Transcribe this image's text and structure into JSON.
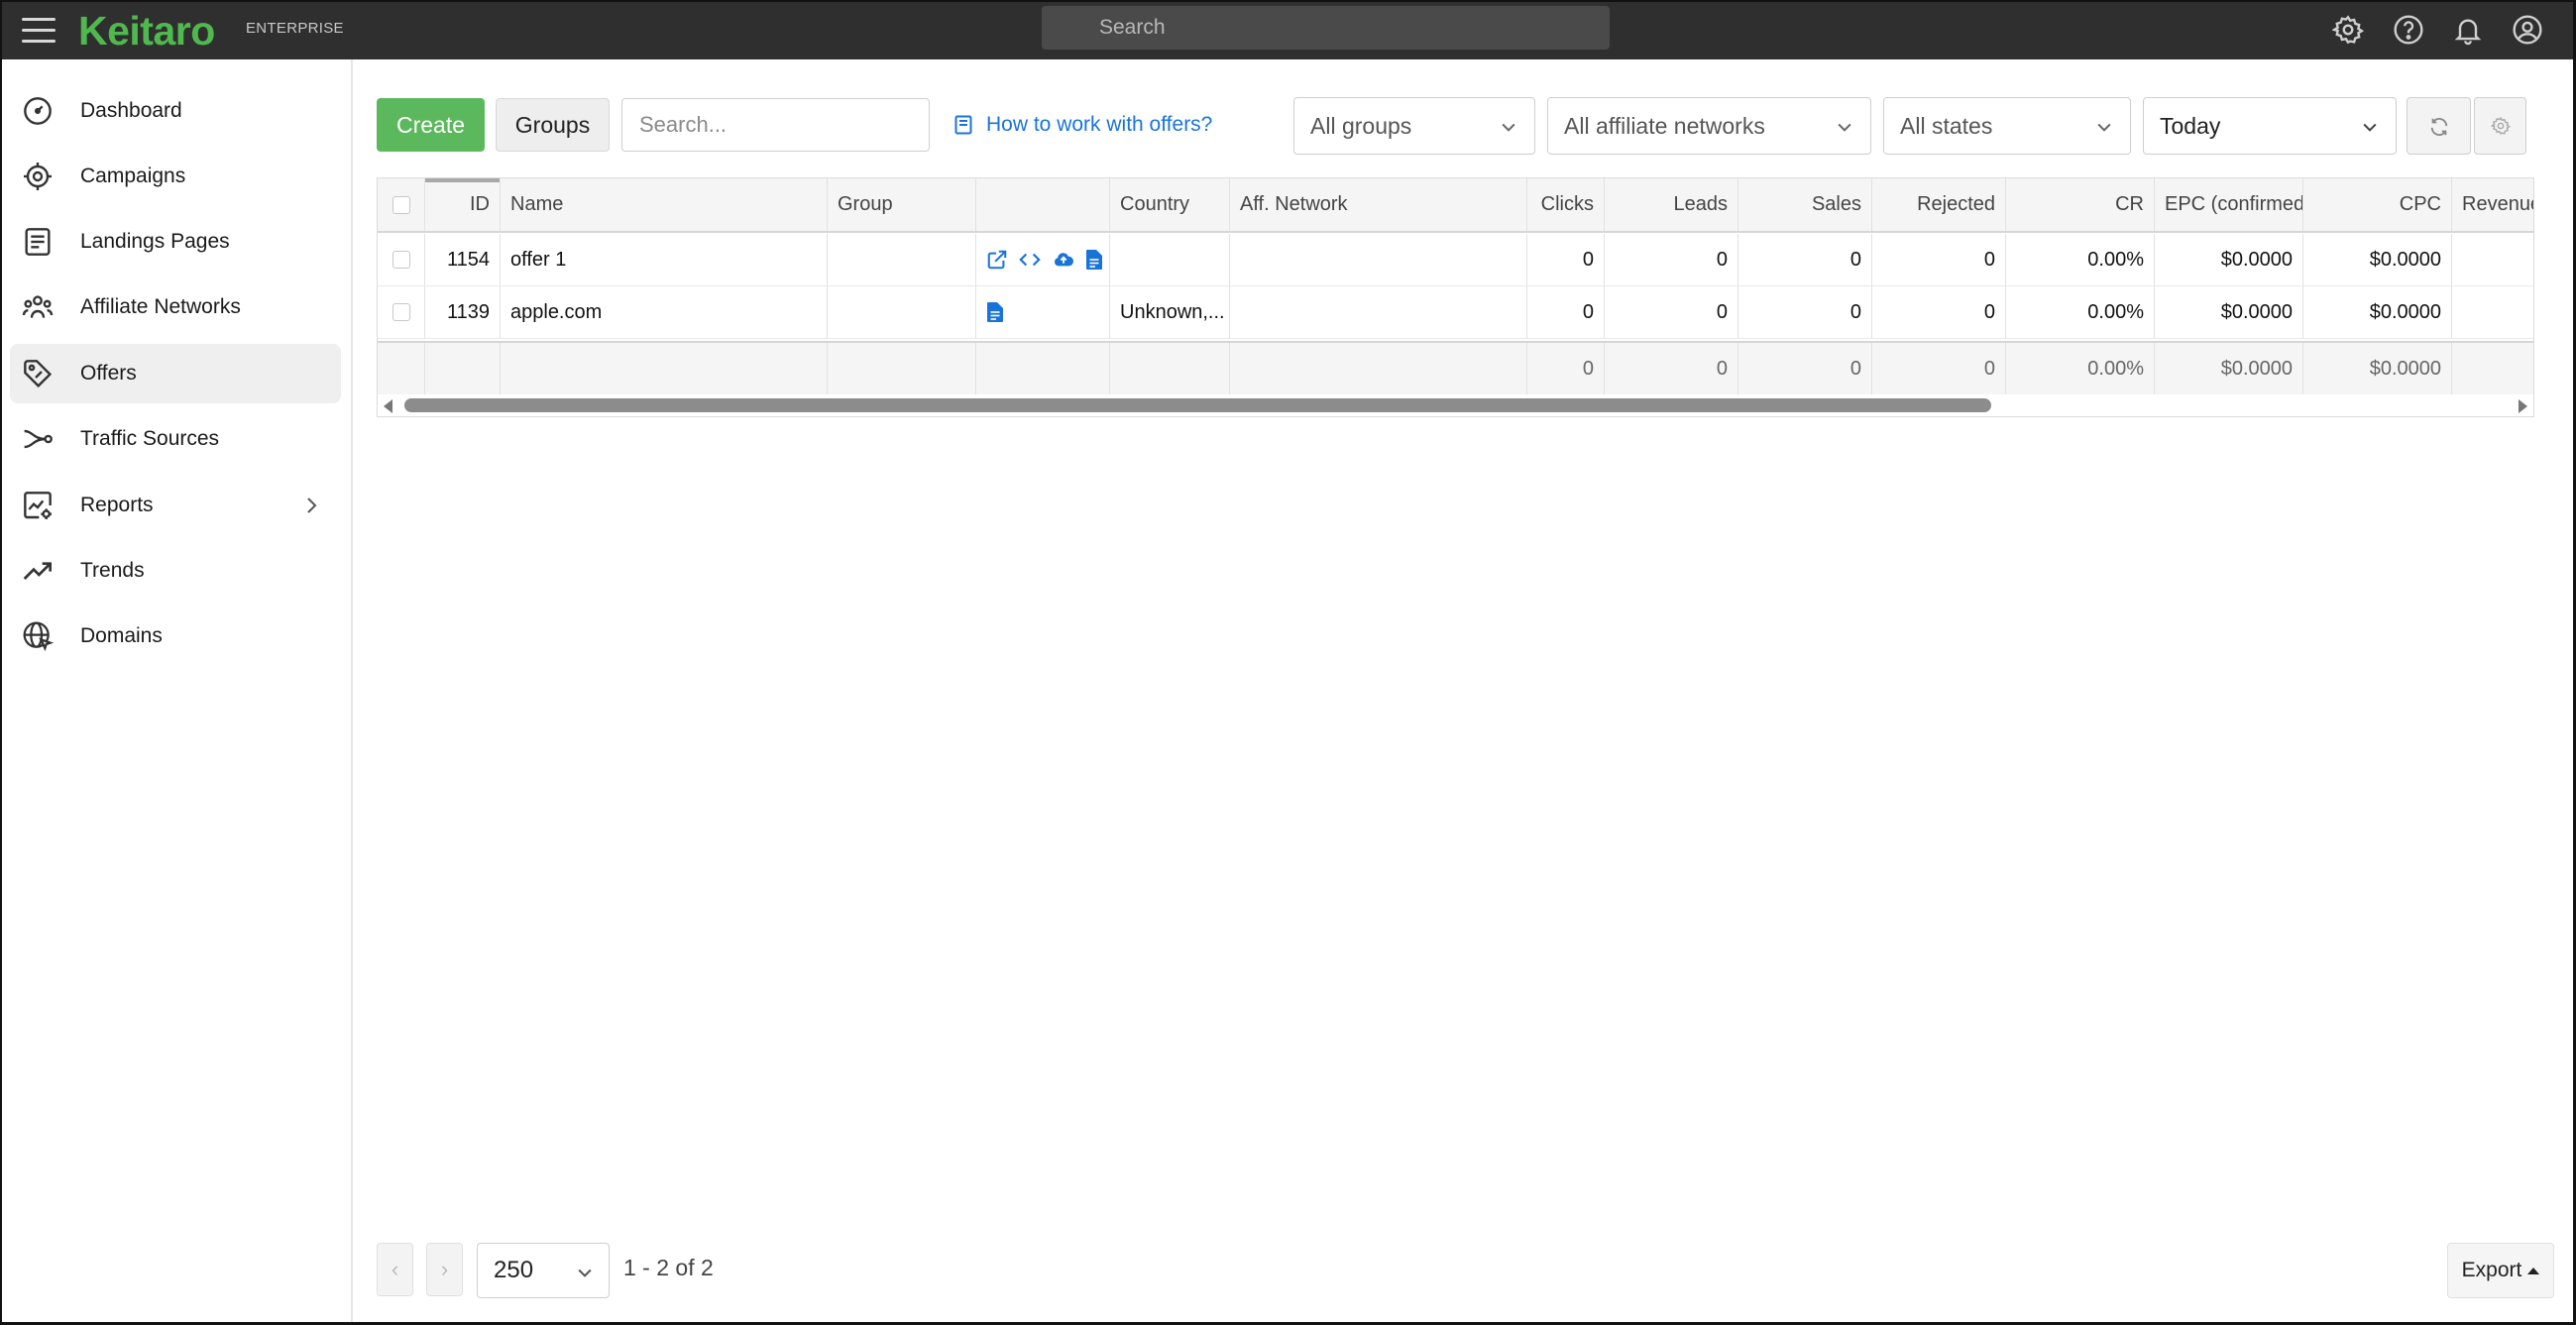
{
  "app": {
    "logo": "Keitaro",
    "edition": "ENTERPRISE",
    "search_placeholder": "Search"
  },
  "sidebar": {
    "items": [
      {
        "label": "Dashboard",
        "icon": "dashboard-icon"
      },
      {
        "label": "Campaigns",
        "icon": "target-icon"
      },
      {
        "label": "Landings Pages",
        "icon": "landing-page-icon"
      },
      {
        "label": "Affiliate Networks",
        "icon": "people-icon"
      },
      {
        "label": "Offers",
        "icon": "tag-icon",
        "active": true
      },
      {
        "label": "Traffic Sources",
        "icon": "route-icon"
      },
      {
        "label": "Reports",
        "icon": "report-icon",
        "has_submenu": true
      },
      {
        "label": "Trends",
        "icon": "trend-icon"
      },
      {
        "label": "Domains",
        "icon": "globe-icon"
      }
    ]
  },
  "toolbar": {
    "create_label": "Create",
    "groups_label": "Groups",
    "search_placeholder": "Search...",
    "help_link": "How to work with offers?",
    "groups_filter": "All groups",
    "networks_filter": "All affiliate networks",
    "states_filter": "All states",
    "date_filter": "Today"
  },
  "table": {
    "columns": [
      "ID",
      "Name",
      "Group",
      "",
      "Country",
      "Aff. Network",
      "Clicks",
      "Leads",
      "Sales",
      "Rejected",
      "CR",
      "EPC (confirmed)",
      "CPC",
      "Revenue"
    ],
    "rows": [
      {
        "id": "1154",
        "name": "offer 1",
        "group": "",
        "country": "",
        "network": "",
        "clicks": "0",
        "leads": "0",
        "sales": "0",
        "rejected": "0",
        "cr": "0.00%",
        "epc": "$0.0000",
        "cpc": "$0.0000",
        "actions": [
          "external-link-icon",
          "code-icon",
          "cloud-upload-icon",
          "document-icon"
        ]
      },
      {
        "id": "1139",
        "name": "apple.com",
        "group": "",
        "country": "Unknown,...",
        "network": "",
        "clicks": "0",
        "leads": "0",
        "sales": "0",
        "rejected": "0",
        "cr": "0.00%",
        "epc": "$0.0000",
        "cpc": "$0.0000",
        "actions": [
          "document-icon"
        ]
      }
    ],
    "totals": {
      "clicks": "0",
      "leads": "0",
      "sales": "0",
      "rejected": "0",
      "cr": "0.00%",
      "epc": "$0.0000",
      "cpc": "$0.0000"
    }
  },
  "footer": {
    "page_size": "250",
    "range": "1 - 2 of 2",
    "export_label": "Export"
  },
  "colors": {
    "brand": "#4fb84e",
    "create_button": "#5cb85c",
    "link": "#1a73d9",
    "topbar": "#2f2f2f"
  }
}
